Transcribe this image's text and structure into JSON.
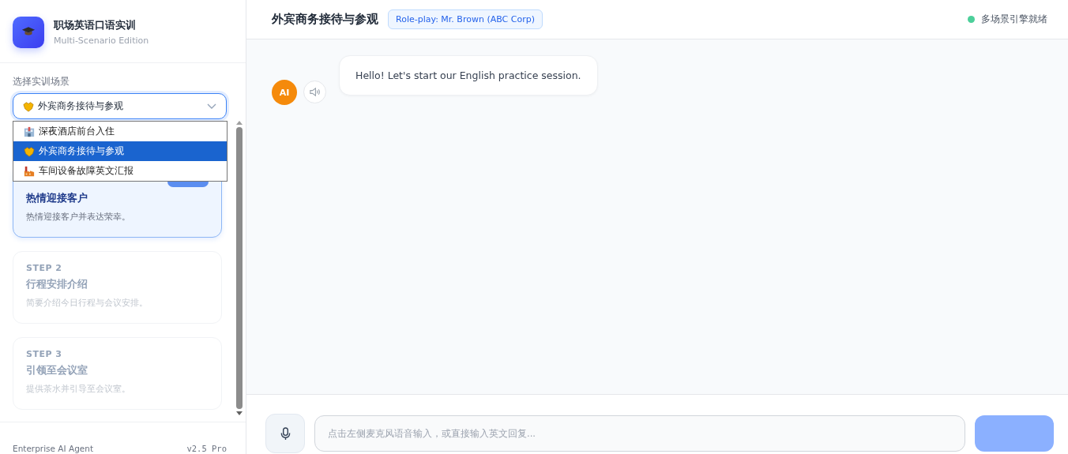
{
  "brand": {
    "title": "职场英语口语实训",
    "subtitle": "Multi-Scenario Edition"
  },
  "scenario_select": {
    "label": "选择实训场景",
    "value": "外宾商务接待与参观",
    "kind": "meeting",
    "expanded": true,
    "options": [
      {
        "label": "深夜酒店前台入住",
        "kind": "hotel",
        "selected": false
      },
      {
        "label": "外宾商务接待与参观",
        "kind": "meeting",
        "selected": true
      },
      {
        "label": "车间设备故障英文汇报",
        "kind": "factory",
        "selected": false
      }
    ]
  },
  "steps": [
    {
      "title": "热情迎接客户",
      "description": "热情迎接客户并表达荣幸。",
      "active": true
    },
    {
      "step": "STEP 2",
      "title": "行程安排介绍",
      "description": "简要介绍今日行程与会议安排。",
      "active": false
    },
    {
      "step": "STEP 3",
      "title": "引领至会议室",
      "description": "提供茶水并引导至会议室。",
      "active": false
    }
  ],
  "sidebar_footer": {
    "left": "Enterprise AI Agent",
    "right": "v2.5 Pro"
  },
  "header": {
    "title": "外宾商务接待与参观",
    "badge": "Role-play: Mr. Brown (ABC Corp)",
    "status": {
      "text": "多场景引擎就绪",
      "color": "#4ccf9a"
    }
  },
  "messages": [
    {
      "sender": "AI",
      "text": "Hello! Let's start our English practice session."
    }
  ],
  "composer": {
    "placeholder": "点击左侧麦克风语音输入，或直接输入英文回复..."
  }
}
